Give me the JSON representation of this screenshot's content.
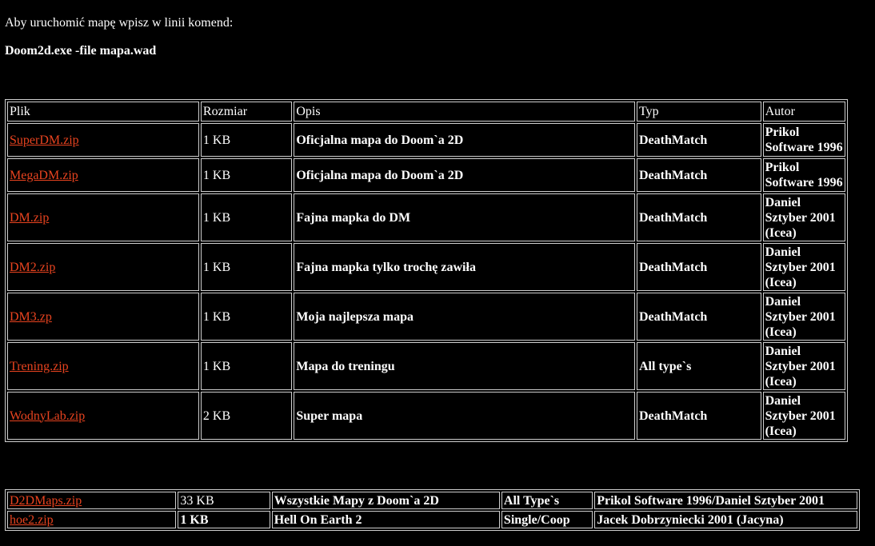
{
  "intro": {
    "text": "Aby uruchomić mapę wpisz w linii komend:",
    "command": "Doom2d.exe -file mapa.wad"
  },
  "colors": {
    "background": "#000000",
    "text": "#ffffff",
    "link": "#e8431f",
    "border": "#cfcfcf"
  },
  "main_table": {
    "headers": [
      "Plik",
      "Rozmiar",
      "Opis",
      "Typ",
      "Autor"
    ],
    "rows": [
      {
        "file": "SuperDM.zip",
        "size": "1 KB",
        "desc": "Oficjalna mapa do Doom`a 2D",
        "type": "DeathMatch",
        "author": "Prikol Software 1996"
      },
      {
        "file": "MegaDM.zip",
        "size": "1 KB",
        "desc": "Oficjalna mapa do Doom`a 2D",
        "type": "DeathMatch",
        "author": "Prikol Software 1996"
      },
      {
        "file": "DM.zip",
        "size": "1 KB",
        "desc": "Fajna mapka do DM",
        "type": "DeathMatch",
        "author": "Daniel Sztyber 2001 (Icea)"
      },
      {
        "file": "DM2.zip",
        "size": "1 KB",
        "desc": "Fajna mapka tylko trochę zawiła",
        "type": "DeathMatch",
        "author": "Daniel Sztyber 2001 (Icea)"
      },
      {
        "file": "DM3.zp",
        "size": "1 KB",
        "desc": "Moja najlepsza mapa",
        "type": "DeathMatch",
        "author": "Daniel Sztyber 2001 (Icea)"
      },
      {
        "file": "Trening.zip",
        "size": "1 KB",
        "desc": "Mapa do treningu",
        "type": "All type`s",
        "author": "Daniel Sztyber 2001 (Icea)"
      },
      {
        "file": "WodnyLab.zip",
        "size": "2 KB",
        "desc": "Super mapa",
        "type": "DeathMatch",
        "author": "Daniel Sztyber 2001 (Icea)"
      }
    ]
  },
  "pack_table": {
    "rows": [
      {
        "file": "D2DMaps.zip",
        "size": "33 KB",
        "desc": "Wszystkie Mapy z Doom`a 2D",
        "type": "All Type`s",
        "author": "Prikol Software 1996/Daniel Sztyber 2001"
      },
      {
        "file": "hoe2.zip",
        "size": "1 KB",
        "desc": "Hell On Earth 2",
        "type": "Single/Coop",
        "author": "Jacek Dobrzyniecki 2001 (Jacyna)"
      }
    ]
  }
}
